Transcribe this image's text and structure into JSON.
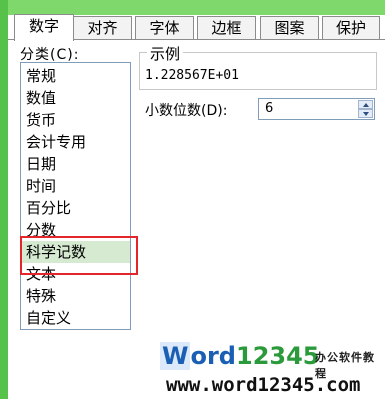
{
  "tabs": [
    {
      "label": "数字",
      "active": true
    },
    {
      "label": "对齐",
      "active": false
    },
    {
      "label": "字体",
      "active": false
    },
    {
      "label": "边框",
      "active": false
    },
    {
      "label": "图案",
      "active": false
    },
    {
      "label": "保护",
      "active": false
    }
  ],
  "category": {
    "label": "分类(C):",
    "items": [
      "常规",
      "数值",
      "货币",
      "会计专用",
      "日期",
      "时间",
      "百分比",
      "分数",
      "科学记数",
      "文本",
      "特殊",
      "自定义"
    ],
    "selected_index": 8
  },
  "sample": {
    "legend": "示例",
    "value": "1.228567E+01"
  },
  "decimal": {
    "label": "小数位数(D):",
    "value": "6"
  },
  "watermark": {
    "logo_w": "W",
    "logo_ord": "ord",
    "logo_num": "12345",
    "tagline": "办公软件教程",
    "url": "www.word12345.com"
  },
  "colors": {
    "selection": "#d6ead1",
    "highlight": "#e2262c",
    "window_edge": "#57c24a"
  }
}
